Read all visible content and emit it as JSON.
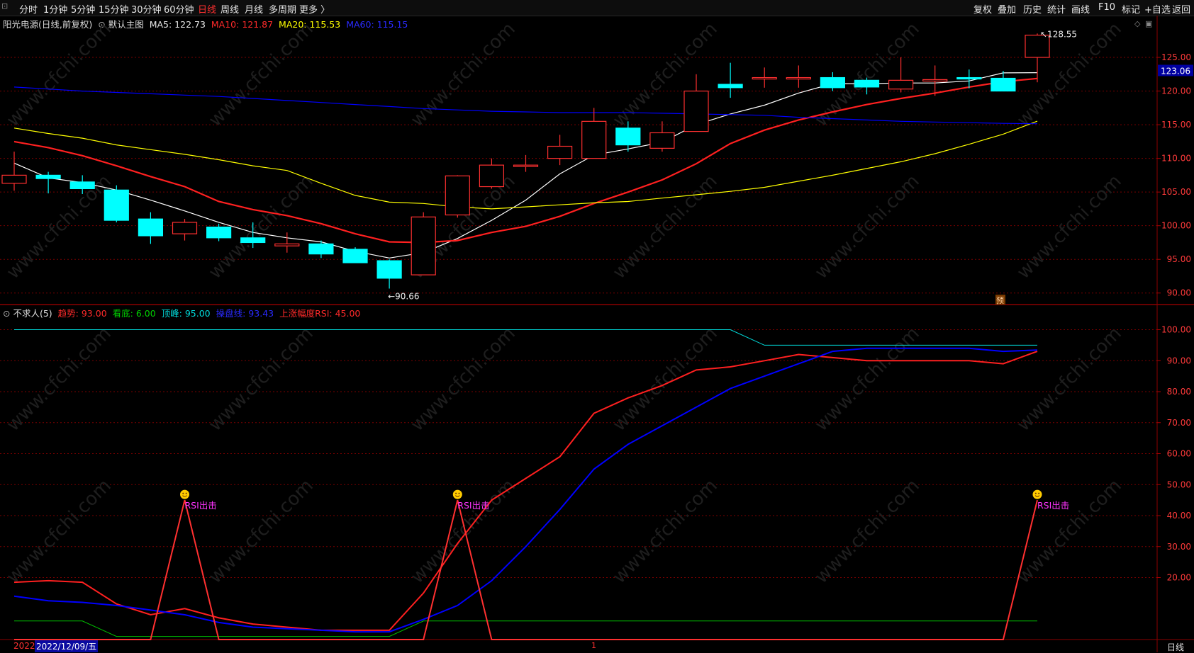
{
  "toolbar": {
    "left": [
      "分时",
      "1分钟",
      "5分钟",
      "15分钟",
      "30分钟",
      "60分钟",
      "日线",
      "周线",
      "月线",
      "多周期",
      "更多 〉"
    ],
    "active": "日线",
    "right": [
      "复权",
      "叠加",
      "历史",
      "统计",
      "画线",
      "F10",
      "标记",
      "+自选",
      "返回"
    ]
  },
  "main_panel": {
    "stock": "阳光电源(日线,前复权)",
    "template": "默认主图",
    "ma5": "MA5: 122.73",
    "ma10": "MA10: 121.87",
    "ma20": "MA20: 115.53",
    "ma60": "MA60: 115.15",
    "high_label": "128.55",
    "low_label": "90.66",
    "current_price": "123.06",
    "forecast_badge": "预"
  },
  "indicator_panel": {
    "name": "不求人(5)",
    "trend": "趋势: 93.00",
    "bottom": "看底: 6.00",
    "top": "顶峰: 95.00",
    "control": "操盘线: 93.43",
    "rsi": "上涨幅度RSI: 45.00",
    "signal_text": "RSI出击"
  },
  "bottom_bar": {
    "year": "2022",
    "date": "2022/12/09/五",
    "period": "日线",
    "marker": "1"
  },
  "colors": {
    "up": "#ff3030",
    "down": "#00ffff",
    "ma5": "#ffffff",
    "ma10": "#ff2020",
    "ma20": "#ffff00",
    "ma60": "#0000ff",
    "top": "#00dddd",
    "bottom_line": "#00c000",
    "signal": "#ff33ff"
  },
  "chart_data": [
    {
      "type": "candlestick",
      "ylim": [
        88.5,
        131
      ],
      "y_ticks": [
        "90.00",
        "95.00",
        "100.00",
        "105.00",
        "110.00",
        "115.00",
        "120.00",
        "125.00"
      ],
      "candles": [
        {
          "o": 106.3,
          "h": 111.0,
          "l": 105.2,
          "c": 107.5
        },
        {
          "o": 107.5,
          "h": 108.0,
          "l": 104.8,
          "c": 107.0
        },
        {
          "o": 106.5,
          "h": 107.5,
          "l": 104.7,
          "c": 105.5
        },
        {
          "o": 105.3,
          "h": 106.0,
          "l": 100.5,
          "c": 100.8
        },
        {
          "o": 101.0,
          "h": 102.0,
          "l": 97.3,
          "c": 98.5
        },
        {
          "o": 98.8,
          "h": 101.0,
          "l": 97.8,
          "c": 100.5
        },
        {
          "o": 99.8,
          "h": 100.3,
          "l": 97.7,
          "c": 98.2
        },
        {
          "o": 98.2,
          "h": 100.5,
          "l": 96.7,
          "c": 97.5
        },
        {
          "o": 97.0,
          "h": 99.0,
          "l": 96.0,
          "c": 97.3
        },
        {
          "o": 97.3,
          "h": 97.8,
          "l": 95.2,
          "c": 95.8
        },
        {
          "o": 96.5,
          "h": 96.8,
          "l": 94.5,
          "c": 94.5
        },
        {
          "o": 94.8,
          "h": 95.0,
          "l": 90.66,
          "c": 92.2
        },
        {
          "o": 92.7,
          "h": 102.0,
          "l": 92.7,
          "c": 101.3
        },
        {
          "o": 101.6,
          "h": 107.5,
          "l": 101.2,
          "c": 107.4
        },
        {
          "o": 105.8,
          "h": 110.0,
          "l": 105.5,
          "c": 109.0
        },
        {
          "o": 109.0,
          "h": 110.5,
          "l": 108.0,
          "c": 109.0
        },
        {
          "o": 110.0,
          "h": 113.5,
          "l": 109.0,
          "c": 111.8
        },
        {
          "o": 110.0,
          "h": 117.5,
          "l": 110.0,
          "c": 115.5
        },
        {
          "o": 114.5,
          "h": 115.5,
          "l": 111.0,
          "c": 112.0
        },
        {
          "o": 111.5,
          "h": 115.5,
          "l": 111.0,
          "c": 113.8
        },
        {
          "o": 114.0,
          "h": 122.5,
          "l": 114.0,
          "c": 120.0
        },
        {
          "o": 121.0,
          "h": 124.2,
          "l": 119.0,
          "c": 120.5
        },
        {
          "o": 121.8,
          "h": 123.5,
          "l": 120.5,
          "c": 122.0
        },
        {
          "o": 122.0,
          "h": 123.8,
          "l": 120.5,
          "c": 122.0
        },
        {
          "o": 122.0,
          "h": 122.8,
          "l": 120.0,
          "c": 120.5
        },
        {
          "o": 121.6,
          "h": 122.0,
          "l": 119.5,
          "c": 120.6
        },
        {
          "o": 120.3,
          "h": 125.0,
          "l": 119.8,
          "c": 121.6
        },
        {
          "o": 121.5,
          "h": 123.8,
          "l": 119.3,
          "c": 121.7
        },
        {
          "o": 122.0,
          "h": 123.2,
          "l": 120.4,
          "c": 121.8
        },
        {
          "o": 121.9,
          "h": 123.0,
          "l": 120.0,
          "c": 120.0
        },
        {
          "o": 125.0,
          "h": 128.55,
          "l": 121.3,
          "c": 128.3
        }
      ],
      "series": [
        {
          "name": "MA5",
          "values": [
            109.3,
            107.1,
            106.4,
            105.3,
            103.8,
            102.2,
            100.5,
            99.0,
            98.2,
            97.6,
            96.2,
            95.2,
            96.0,
            98.1,
            100.8,
            103.8,
            107.7,
            110.5,
            111.4,
            112.4,
            115.0,
            116.6,
            117.9,
            119.7,
            121.1,
            121.1,
            121.2,
            121.2,
            121.5,
            122.7,
            122.73
          ]
        },
        {
          "name": "MA10",
          "values": [
            112.5,
            111.6,
            110.4,
            108.9,
            107.3,
            105.8,
            103.6,
            102.4,
            101.5,
            100.3,
            98.8,
            97.6,
            97.5,
            97.8,
            99.0,
            99.9,
            101.4,
            103.3,
            105.0,
            106.8,
            109.2,
            112.2,
            114.2,
            115.7,
            116.9,
            118.0,
            118.9,
            119.7,
            120.6,
            121.4,
            121.87
          ]
        },
        {
          "name": "MA20",
          "values": [
            114.5,
            113.7,
            113.0,
            112.0,
            111.3,
            110.6,
            109.8,
            108.9,
            108.2,
            106.3,
            104.5,
            103.5,
            103.3,
            102.8,
            102.5,
            102.8,
            103.1,
            103.4,
            103.6,
            104.1,
            104.6,
            105.1,
            105.7,
            106.6,
            107.5,
            108.5,
            109.5,
            110.7,
            112.1,
            113.6,
            115.53
          ]
        },
        {
          "name": "MA60",
          "values": [
            120.6,
            120.3,
            120.0,
            119.8,
            119.6,
            119.4,
            119.2,
            118.9,
            118.6,
            118.3,
            118.0,
            117.7,
            117.4,
            117.2,
            117.0,
            116.9,
            116.8,
            116.8,
            116.8,
            116.7,
            116.6,
            116.5,
            116.4,
            116.1,
            115.9,
            115.7,
            115.5,
            115.4,
            115.3,
            115.2,
            115.15
          ]
        }
      ]
    },
    {
      "type": "line",
      "ylim": [
        0,
        104
      ],
      "y_ticks": [
        "20.00",
        "30.00",
        "40.00",
        "50.00",
        "60.00",
        "70.00",
        "80.00",
        "90.00",
        "100.00"
      ],
      "series": [
        {
          "name": "趋势",
          "values": [
            18.5,
            19,
            18.5,
            11.5,
            8,
            10,
            7,
            5,
            4,
            3,
            3,
            3,
            15,
            31,
            45,
            52,
            59,
            73,
            78,
            82,
            87,
            88,
            90,
            92,
            91,
            90,
            90,
            90,
            90,
            89,
            93
          ]
        },
        {
          "name": "操盘线",
          "values": [
            14,
            12.5,
            12,
            11,
            9.5,
            8,
            5.5,
            4,
            3.5,
            3,
            2.5,
            2.5,
            6.5,
            11,
            19,
            30,
            42,
            55,
            63,
            69,
            75,
            81,
            85,
            89,
            93,
            94,
            94,
            94,
            94,
            93,
            93.43
          ]
        },
        {
          "name": "顶峰",
          "values": [
            100,
            100,
            100,
            100,
            100,
            100,
            100,
            100,
            100,
            100,
            100,
            100,
            100,
            100,
            100,
            100,
            100,
            100,
            100,
            100,
            100,
            100,
            95,
            95,
            95,
            95,
            95,
            95,
            95,
            95,
            95
          ]
        },
        {
          "name": "看底",
          "values": [
            6,
            6,
            6,
            1,
            1,
            1,
            1,
            1,
            1,
            1,
            1,
            1,
            6,
            6,
            6,
            6,
            6,
            6,
            6,
            6,
            6,
            6,
            6,
            6,
            6,
            6,
            6,
            6,
            6,
            6,
            6
          ]
        },
        {
          "name": "上涨幅度RSI",
          "values": [
            0,
            0,
            0,
            0,
            0,
            45,
            0,
            0,
            0,
            0,
            0,
            0,
            0,
            45,
            0,
            0,
            0,
            0,
            0,
            0,
            0,
            0,
            0,
            0,
            0,
            0,
            0,
            0,
            0,
            0,
            45
          ]
        }
      ],
      "signals": [
        5,
        13,
        30
      ]
    }
  ]
}
